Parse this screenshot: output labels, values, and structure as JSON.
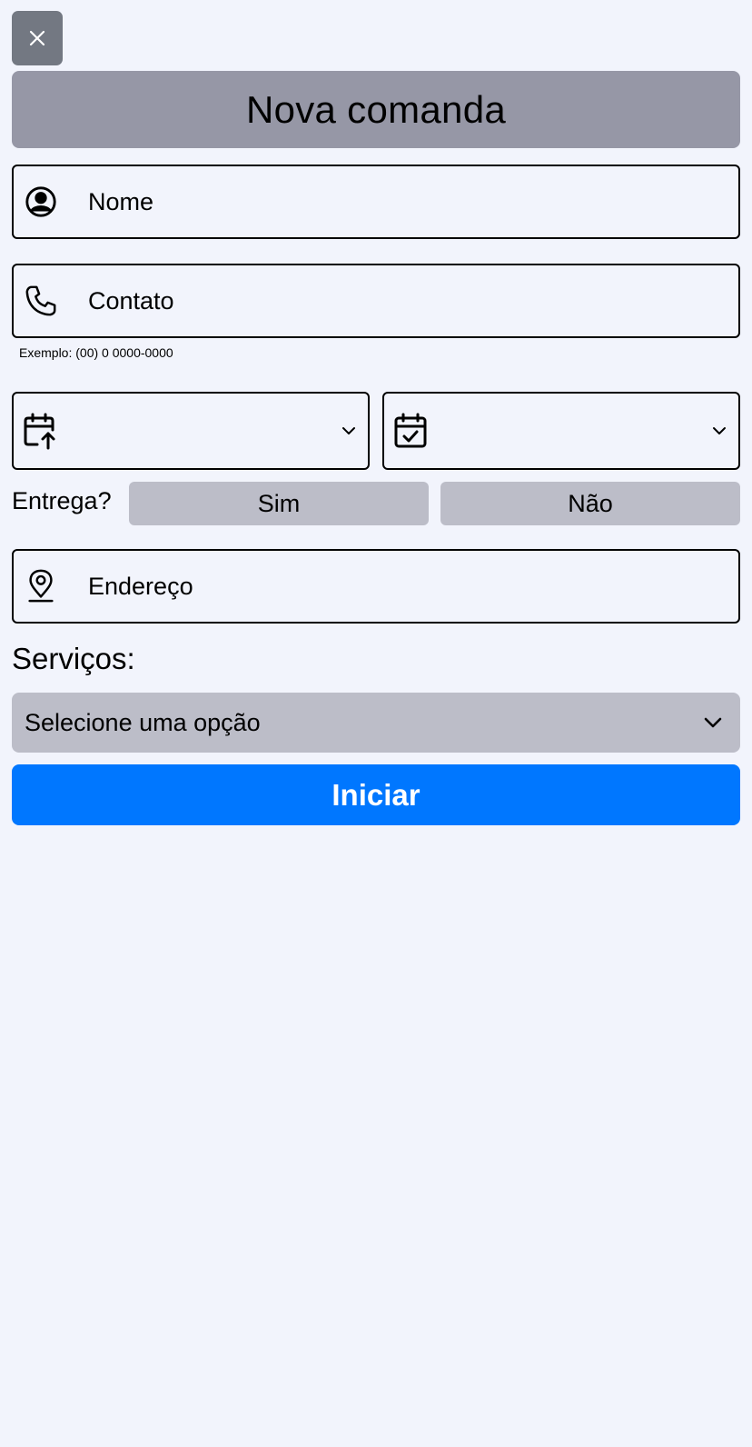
{
  "header": {
    "close_icon": "close-icon",
    "title": "Nova comanda"
  },
  "form": {
    "name": {
      "icon": "user-circle-icon",
      "placeholder": "Nome",
      "value": ""
    },
    "contact": {
      "icon": "phone-icon",
      "placeholder": "Contato",
      "value": "",
      "hint": "Exemplo: (00) 0 0000-0000"
    },
    "date_start": {
      "icon": "calendar-arrow-up-icon",
      "value": ""
    },
    "date_end": {
      "icon": "calendar-check-icon",
      "value": ""
    },
    "delivery": {
      "label": "Entrega?",
      "yes_label": "Sim",
      "no_label": "Não"
    },
    "address": {
      "icon": "map-pin-icon",
      "placeholder": "Endereço",
      "value": ""
    },
    "services": {
      "label": "Serviços:",
      "selected": "Selecione uma opção"
    },
    "submit_label": "Iniciar"
  },
  "colors": {
    "background": "#f2f4fc",
    "close_button": "#737882",
    "title_bar": "#9697a6",
    "option_button": "#bcbdc8",
    "primary": "#0077ff"
  }
}
